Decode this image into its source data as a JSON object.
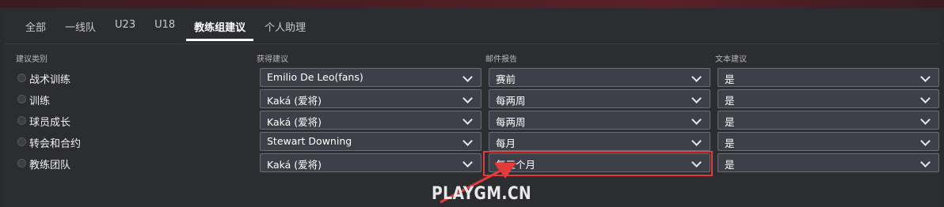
{
  "tabs": [
    "全部",
    "一线队",
    "U23",
    "U18",
    "教练组建议",
    "个人助理"
  ],
  "active_tab_index": 4,
  "columns": {
    "category": "建议类别",
    "advice_source": "获得建议",
    "email_report": "邮件报告",
    "text_advice": "文本建议"
  },
  "rows": [
    {
      "label": "战术训练",
      "source": "Emilio De Leo(fans)",
      "report": "赛前",
      "text": "是"
    },
    {
      "label": "训练",
      "source": "Kaká (爱将)",
      "report": "每两周",
      "text": "是"
    },
    {
      "label": "球员成长",
      "source": "Kaká (爱将)",
      "report": "每两周",
      "text": "是"
    },
    {
      "label": "转会和合约",
      "source": "Stewart Downing",
      "report": "每月",
      "text": "是"
    },
    {
      "label": "教练团队",
      "source": "Kaká (爱将)",
      "report": "每三个月",
      "text": "是"
    }
  ],
  "annotation": {
    "highlight_color": "#e53a3a"
  },
  "watermark": "PLAYGM.CN",
  "colors": {
    "background": "#2c2d31",
    "select_bg": "#3d4048",
    "select_border": "#6a6d74",
    "accent_top": "#4a1e22"
  }
}
